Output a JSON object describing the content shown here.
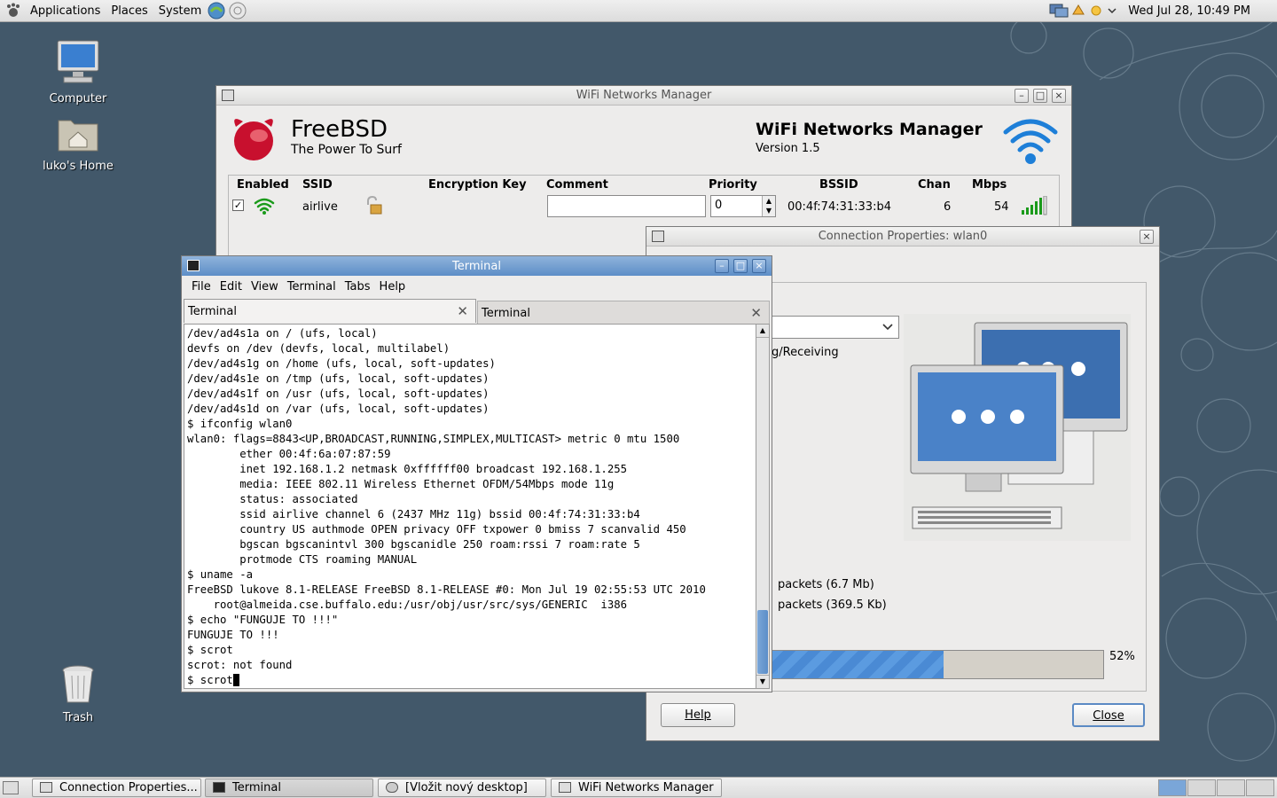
{
  "top_panel": {
    "menus": [
      "Applications",
      "Places",
      "System"
    ],
    "clock": "Wed Jul 28, 10:49 PM"
  },
  "desktop_icons": [
    {
      "label": "Computer"
    },
    {
      "label": "luko's Home"
    },
    {
      "label": "Trash"
    }
  ],
  "wifi_manager": {
    "window_title": "WiFi Networks Manager",
    "brand": "FreeBSD",
    "tagline": "The Power To Surf",
    "app_title": "WiFi Networks Manager",
    "version": "Version 1.5",
    "columns": [
      "Enabled",
      "SSID",
      "Encryption Key",
      "Comment",
      "Priority",
      "BSSID",
      "Chan",
      "Mbps"
    ],
    "row": {
      "enabled": true,
      "ssid": "airlive",
      "comment": "",
      "priority": "0",
      "bssid": "00:4f:74:31:33:b4",
      "chan": "6",
      "mbps": "54"
    }
  },
  "connection_props": {
    "window_title": "Connection Properties: wlan0",
    "receiving_text": "g/Receiving",
    "packets_sent": "packets (6.7 Mb)",
    "packets_received": "packets (369.5 Kb)",
    "signal_percent": 52,
    "signal_text": "52%",
    "help_label": "Help",
    "close_label": "Close"
  },
  "terminal": {
    "window_title": "Terminal",
    "menus": [
      "File",
      "Edit",
      "View",
      "Terminal",
      "Tabs",
      "Help"
    ],
    "tabs": [
      "Terminal",
      "Terminal"
    ],
    "lines": [
      "/dev/ad4s1a on / (ufs, local)",
      "devfs on /dev (devfs, local, multilabel)",
      "/dev/ad4s1g on /home (ufs, local, soft-updates)",
      "/dev/ad4s1e on /tmp (ufs, local, soft-updates)",
      "/dev/ad4s1f on /usr (ufs, local, soft-updates)",
      "/dev/ad4s1d on /var (ufs, local, soft-updates)",
      "$ ifconfig wlan0",
      "wlan0: flags=8843<UP,BROADCAST,RUNNING,SIMPLEX,MULTICAST> metric 0 mtu 1500",
      "        ether 00:4f:6a:07:87:59",
      "        inet 192.168.1.2 netmask 0xffffff00 broadcast 192.168.1.255",
      "        media: IEEE 802.11 Wireless Ethernet OFDM/54Mbps mode 11g",
      "        status: associated",
      "        ssid airlive channel 6 (2437 MHz 11g) bssid 00:4f:74:31:33:b4",
      "        country US authmode OPEN privacy OFF txpower 0 bmiss 7 scanvalid 450",
      "        bgscan bgscanintvl 300 bgscanidle 250 roam:rssi 7 roam:rate 5",
      "        protmode CTS roaming MANUAL",
      "$ uname -a",
      "FreeBSD lukove 8.1-RELEASE FreeBSD 8.1-RELEASE #0: Mon Jul 19 02:55:53 UTC 2010",
      "    root@almeida.cse.buffalo.edu:/usr/obj/usr/src/sys/GENERIC  i386",
      "$ echo \"FUNGUJE TO !!!\"",
      "FUNGUJE TO !!!",
      "$ scrot",
      "scrot: not found"
    ],
    "prompt_line": "$ scrot"
  },
  "taskbar": [
    {
      "label": "Connection Properties..."
    },
    {
      "label": "Terminal"
    },
    {
      "label": "[Vložit nový desktop]"
    },
    {
      "label": "WiFi Networks Manager"
    }
  ]
}
